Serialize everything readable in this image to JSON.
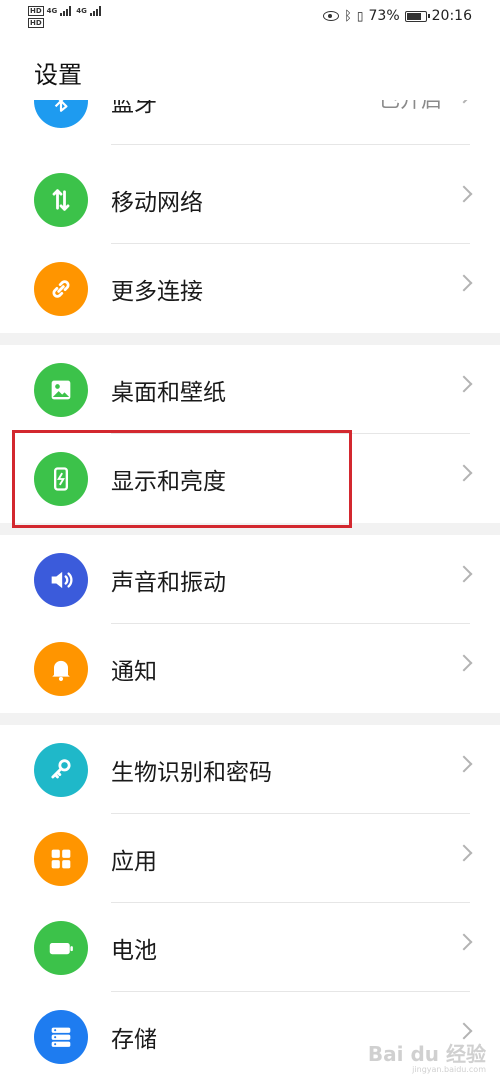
{
  "status_bar": {
    "hd_label": "HD",
    "network_1": "4G",
    "network_2": "4G",
    "battery_percent": "73%",
    "time": "20:16",
    "battery_level": 0.73
  },
  "page": {
    "title": "设置"
  },
  "items": [
    {
      "label": "蓝牙",
      "value": "已开启",
      "icon": "bluetooth-icon",
      "color": "#1e9bf0"
    },
    {
      "label": "移动网络",
      "icon": "mobile-network-icon",
      "color": "#3cc24a"
    },
    {
      "label": "更多连接",
      "icon": "link-icon",
      "color": "#ff9500"
    },
    {
      "label": "桌面和壁纸",
      "icon": "wallpaper-icon",
      "color": "#3cc24a"
    },
    {
      "label": "显示和亮度",
      "icon": "display-brightness-icon",
      "color": "#3cc24a"
    },
    {
      "label": "声音和振动",
      "icon": "speaker-icon",
      "color": "#3b5bdb"
    },
    {
      "label": "通知",
      "icon": "bell-icon",
      "color": "#ff9500"
    },
    {
      "label": "生物识别和密码",
      "icon": "key-icon",
      "color": "#1fb8c9"
    },
    {
      "label": "应用",
      "icon": "apps-grid-icon",
      "color": "#ff9500"
    },
    {
      "label": "电池",
      "icon": "battery-icon",
      "color": "#3cc24a"
    },
    {
      "label": "存储",
      "icon": "storage-icon",
      "color": "#1e7cf0"
    }
  ],
  "watermark": {
    "text": "Bai du 经验",
    "sub": "jingyan.baidu.com"
  }
}
